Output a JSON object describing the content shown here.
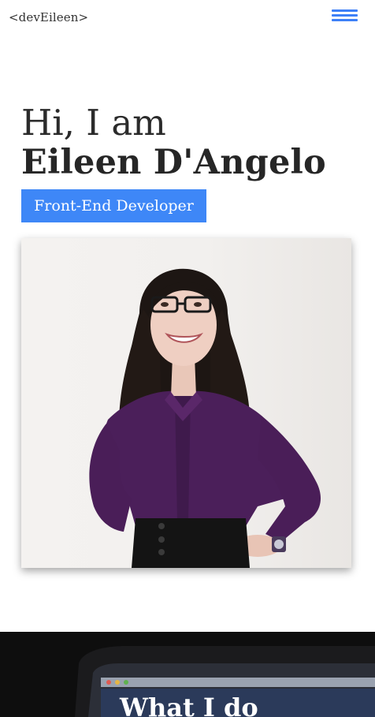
{
  "nav": {
    "logo": "<devEileen>",
    "menu_icon": "hamburger-icon",
    "accent": "#3d80f7"
  },
  "hero": {
    "greeting": "Hi, I am",
    "name": "Eileen D'Angelo",
    "role": "Front-End Developer",
    "role_bg": "#3e87f7"
  },
  "portrait": {
    "subject": "portrait-photo"
  },
  "section": {
    "title": "What I do",
    "bg": "#0e0e0e"
  }
}
